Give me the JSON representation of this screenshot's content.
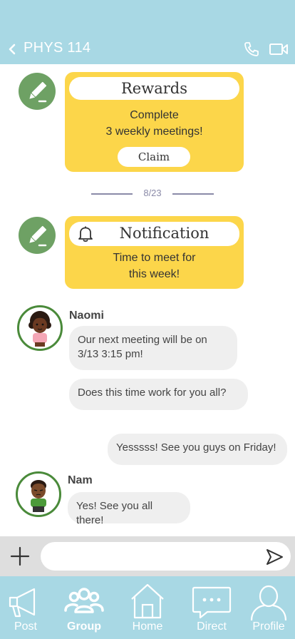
{
  "header": {
    "title": "PHYS 114",
    "back_icon": "chevron-left-icon",
    "phone_icon": "phone-icon",
    "video_icon": "video-camera-icon"
  },
  "rewards_card": {
    "title": "Rewards",
    "line1": "Complete",
    "line2": "3 weekly meetings!",
    "claim_label": "Claim"
  },
  "date_separator": "8/23",
  "notification_card": {
    "title": "Notification",
    "line1": "Time to meet for",
    "line2": "this week!",
    "icon": "bell-icon"
  },
  "messages": [
    {
      "sender": "Naomi",
      "text": "Our next meeting will be on 3/13 3:15 pm!"
    },
    {
      "sender": "Naomi",
      "text": "Does this time work for you all?"
    },
    {
      "sender": "me",
      "text": "Yesssss! See you guys on Friday!"
    },
    {
      "sender": "Nam",
      "text": "Yes! See you all there!"
    }
  ],
  "composer": {
    "value": "",
    "placeholder": "",
    "add_icon": "plus-icon",
    "send_icon": "send-icon"
  },
  "tabs": [
    {
      "label": "Post",
      "icon": "megaphone-icon",
      "active": false
    },
    {
      "label": "Group",
      "icon": "group-icon",
      "active": true
    },
    {
      "label": "Home",
      "icon": "home-icon",
      "active": false
    },
    {
      "label": "Direct",
      "icon": "chat-bubble-icon",
      "active": false
    },
    {
      "label": "Profile",
      "icon": "profile-icon",
      "active": false
    }
  ],
  "colors": {
    "header_bg": "#a8d8e4",
    "card_yellow": "#fcd64a",
    "pencil_green": "#6ea164",
    "bubble_gray": "#efefef",
    "composer_bg": "#dedede"
  }
}
